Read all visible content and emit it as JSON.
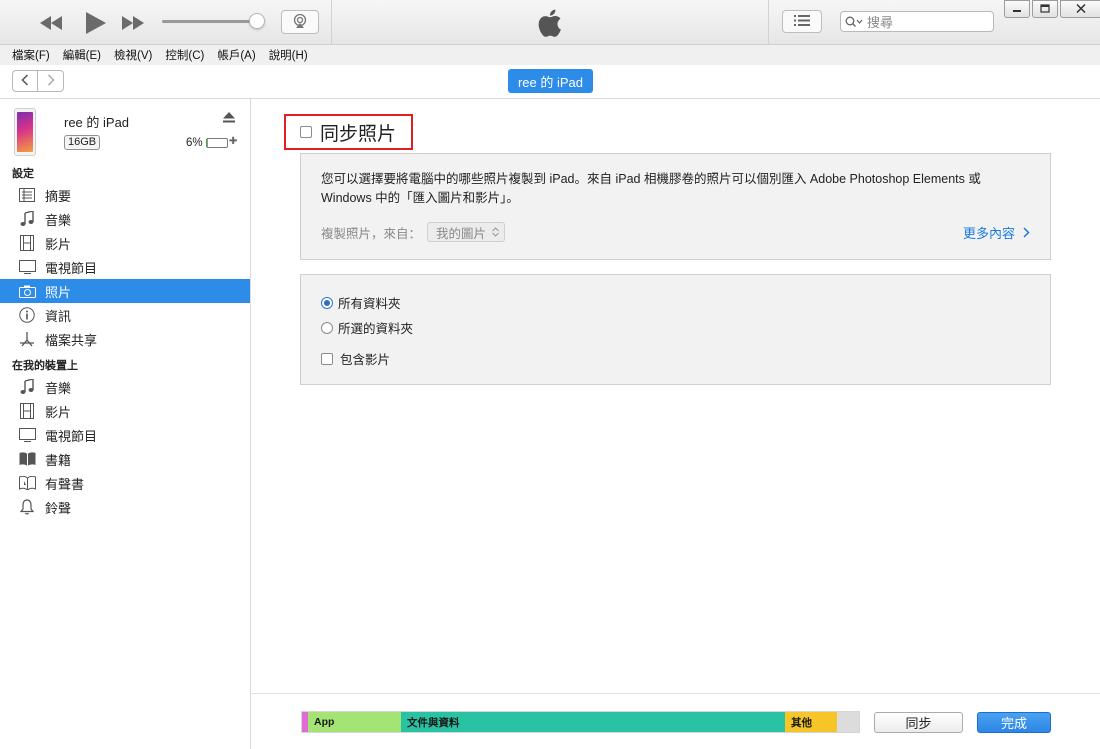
{
  "player": {
    "search_placeholder": "搜尋"
  },
  "menu": {
    "items": [
      "檔案(F)",
      "編輯(E)",
      "檢視(V)",
      "控制(C)",
      "帳戶(A)",
      "說明(H)"
    ]
  },
  "nav": {
    "device_tab": "ree 的 iPad"
  },
  "device": {
    "name": "ree 的 iPad",
    "capacity": "16GB",
    "battery_percent": "6%",
    "battery_level": 0.06
  },
  "sidebar": {
    "settings_header": "設定",
    "settings_items": [
      {
        "label": "摘要",
        "icon": "summary-icon"
      },
      {
        "label": "音樂",
        "icon": "music-icon"
      },
      {
        "label": "影片",
        "icon": "movie-icon"
      },
      {
        "label": "電視節目",
        "icon": "tv-icon"
      },
      {
        "label": "照片",
        "icon": "camera-icon",
        "active": true
      },
      {
        "label": "資訊",
        "icon": "info-icon"
      },
      {
        "label": "檔案共享",
        "icon": "file-sharing-icon"
      }
    ],
    "ondevice_header": "在我的裝置上",
    "ondevice_items": [
      {
        "label": "音樂",
        "icon": "music-icon"
      },
      {
        "label": "影片",
        "icon": "movie-icon"
      },
      {
        "label": "電視節目",
        "icon": "tv-icon"
      },
      {
        "label": "書籍",
        "icon": "book-icon"
      },
      {
        "label": "有聲書",
        "icon": "audiobook-icon"
      },
      {
        "label": "鈴聲",
        "icon": "bell-icon"
      }
    ]
  },
  "main": {
    "sync_title": "同步照片",
    "description": "您可以選擇要將電腦中的哪些照片複製到 iPad。來自 iPad 相機膠卷的照片可以個別匯入 Adobe Photoshop Elements 或 Windows 中的「匯入圖片和影片」。",
    "copy_from_label": "複製照片，來自：",
    "copy_from_value": "我的圖片",
    "more_link": "更多內容",
    "options": {
      "all_folders": "所有資料夾",
      "selected_folders": "所選的資料夾",
      "include_videos": "包含影片"
    }
  },
  "footer": {
    "segments": [
      {
        "label": "",
        "fraction": 0.011,
        "color": "#e06ad6"
      },
      {
        "label": "App",
        "fraction": 0.167,
        "color": "#a3e474"
      },
      {
        "label": "文件與資料",
        "fraction": 0.69,
        "color": "#29c2a3"
      },
      {
        "label": "其他",
        "fraction": 0.093,
        "color": "#f6c628"
      },
      {
        "label": "",
        "fraction": 0.039,
        "color": "#dcdcdc"
      }
    ],
    "sync_button": "同步",
    "done_button": "完成"
  },
  "colors": {
    "accent": "#2d8ce8",
    "highlight_border": "#e02020",
    "link": "#1a7ae0"
  }
}
